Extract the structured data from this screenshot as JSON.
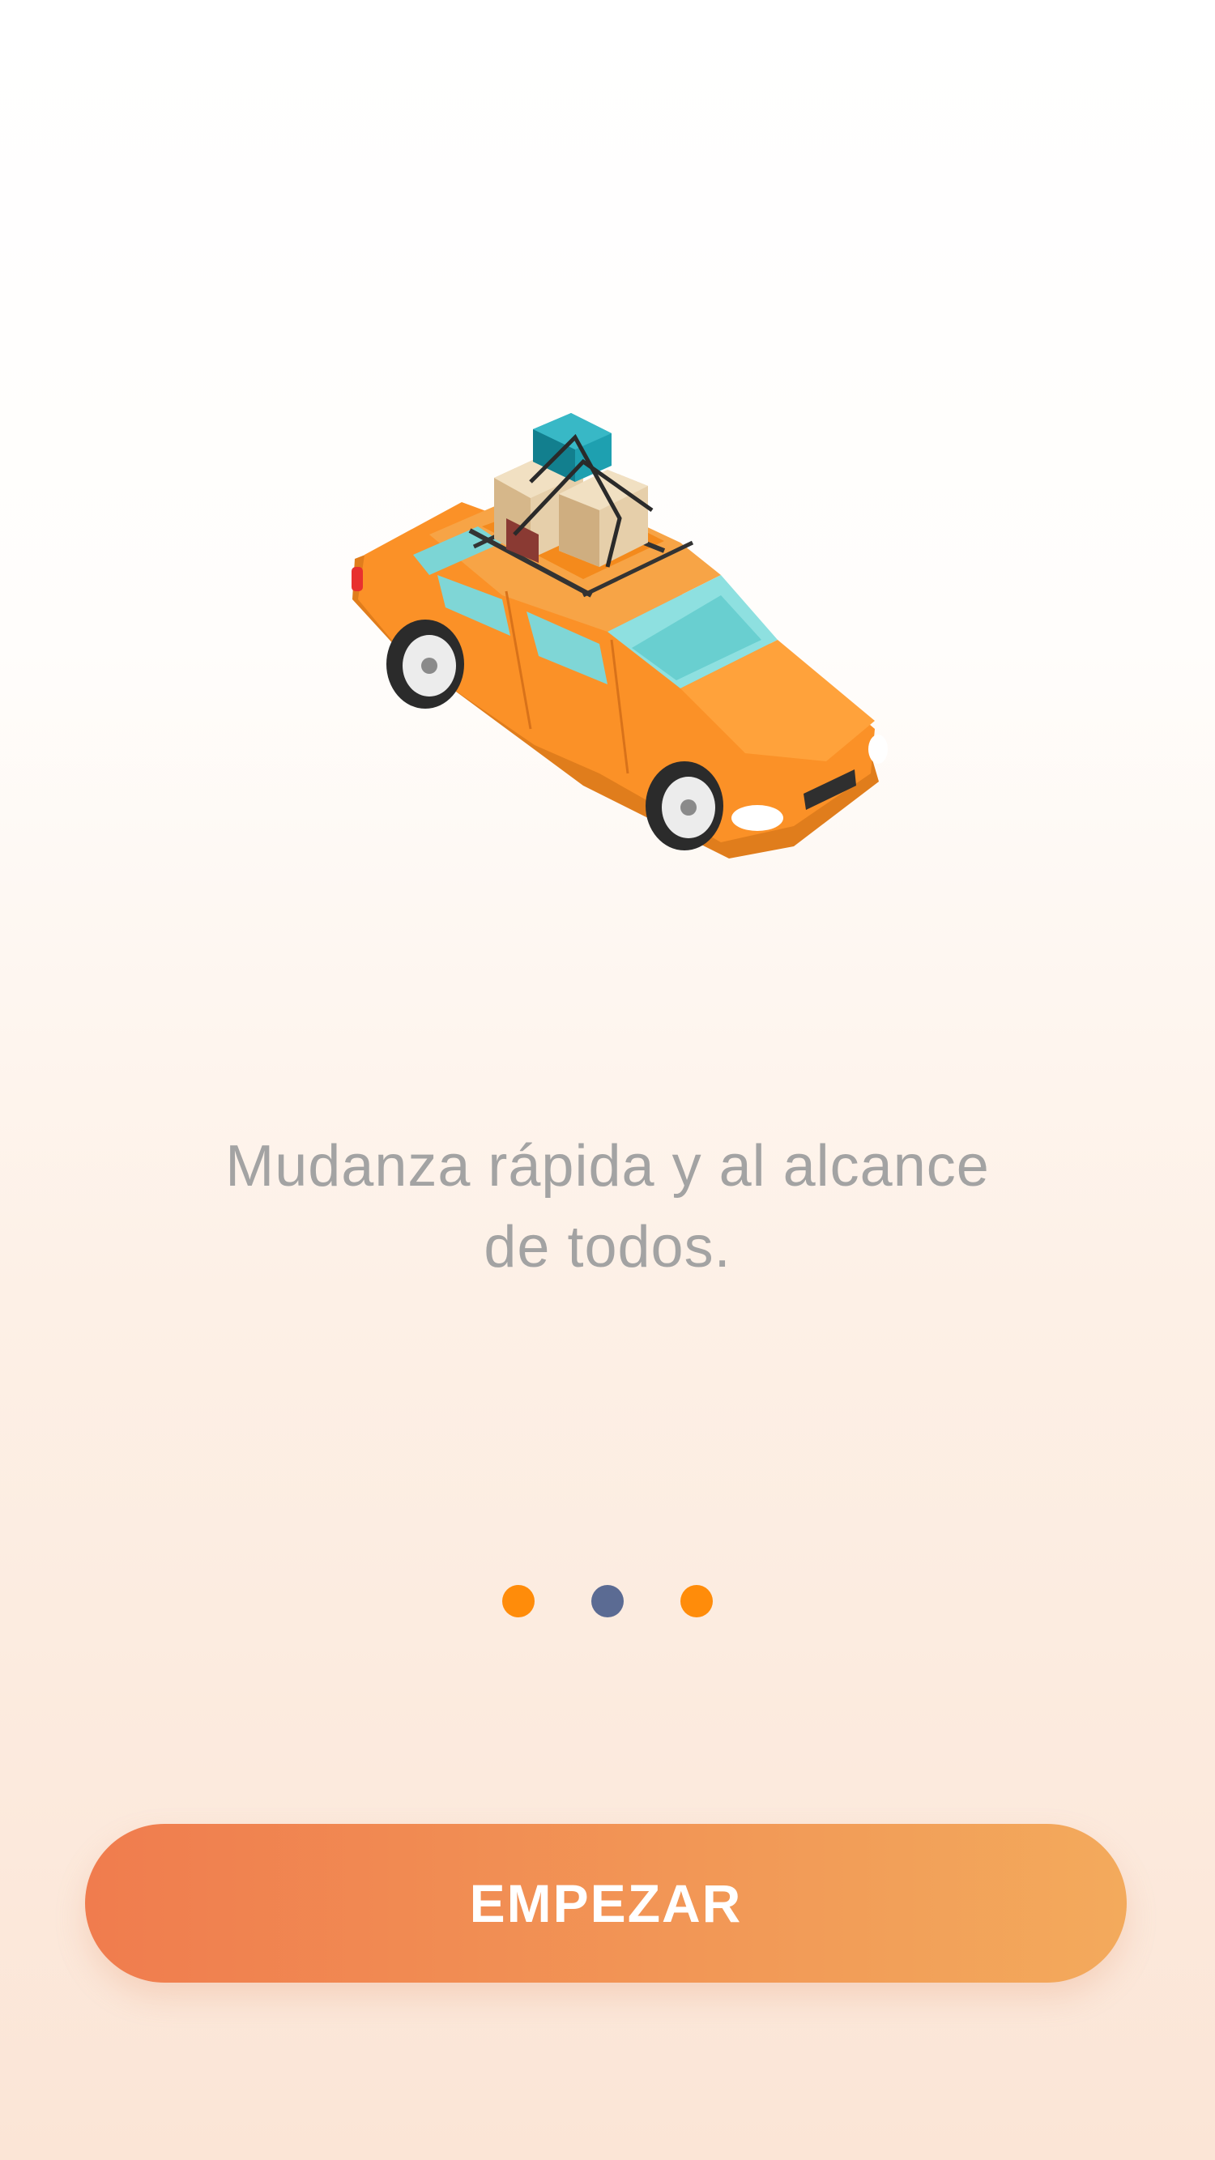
{
  "onboarding": {
    "illustration": "car-with-luggage-icon",
    "tagline_line1": "Mudanza rápida y al alcance",
    "tagline_line2": "de todos."
  },
  "pager": {
    "count": 3,
    "active_index": 1,
    "active_color": "#5b6b93",
    "inactive_color": "#ff8c0a"
  },
  "cta": {
    "label": "EMPEZAR",
    "gradient_start": "#f07c4e",
    "gradient_end": "#f3aa5c"
  }
}
